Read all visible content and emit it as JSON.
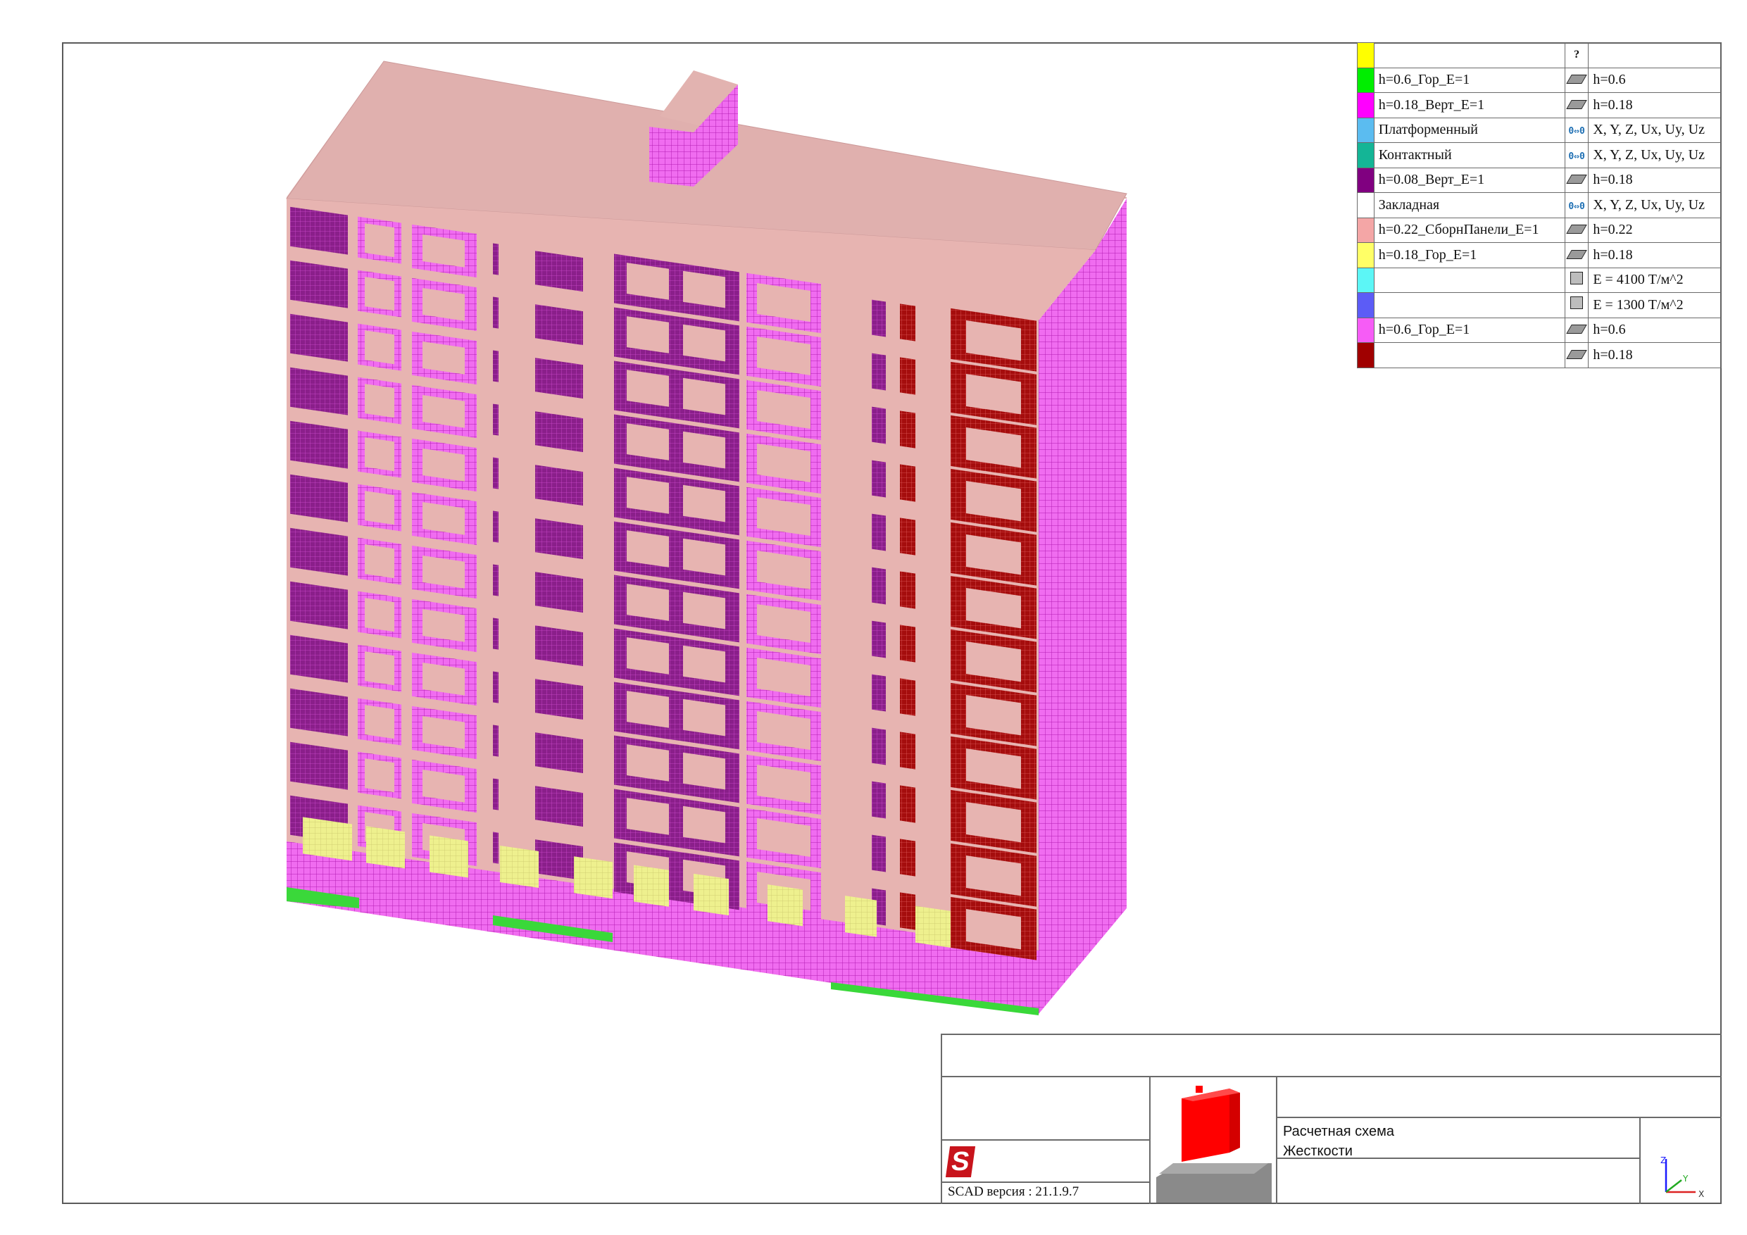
{
  "legend": {
    "header": {
      "icon": "?",
      "color": "#ffff00"
    },
    "rows": [
      {
        "color": "#00ee00",
        "name": "h=0.6_Гор_E=1",
        "icon": "plate-icon",
        "value": "h=0.6"
      },
      {
        "color": "#ff00ff",
        "name": "h=0.18_Верт_E=1",
        "icon": "plate-icon",
        "value": "h=0.18"
      },
      {
        "color": "#5bbcf0",
        "name": "Платформенный",
        "icon": "link-icon",
        "value": "X, Y, Z, Ux, Uy, Uz"
      },
      {
        "color": "#14b596",
        "name": "Контактный",
        "icon": "link-icon",
        "value": "X, Y, Z, Ux, Uy, Uz"
      },
      {
        "color": "#800080",
        "name": "h=0.08_Верт_E=1",
        "icon": "plate-icon",
        "value": "h=0.18"
      },
      {
        "color": "#ffffff",
        "name": "Закладная",
        "icon": "link-icon",
        "value": "X, Y, Z, Ux, Uy, Uz"
      },
      {
        "color": "#f4a6a6",
        "name": "h=0.22_СборнПанели_E=1",
        "icon": "plate-icon",
        "value": "h=0.22"
      },
      {
        "color": "#ffff66",
        "name": "h=0.18_Гор_E=1",
        "icon": "plate-icon",
        "value": "h=0.18"
      },
      {
        "color": "#5cf6f6",
        "name": "",
        "icon": "solid-icon",
        "value": "E = 4100 Т/м^2"
      },
      {
        "color": "#5c5cf6",
        "name": "",
        "icon": "solid-icon",
        "value": "E = 1300 Т/м^2"
      },
      {
        "color": "#f65cf6",
        "name": "h=0.6_Гор_E=1",
        "icon": "plate-icon",
        "value": "h=0.6"
      },
      {
        "color": "#a00000",
        "name": "",
        "icon": "plate-icon",
        "value": "h=0.18"
      }
    ]
  },
  "titleblock": {
    "version_label": "SCAD версия : 21.1.9.7",
    "line1": "Расчетная схема",
    "line2": "Жесткости",
    "axes": {
      "z": "Z",
      "y": "Y",
      "x": "X"
    }
  },
  "colors": {
    "roof": "#e0b0ae",
    "facade": "#e7b4b1",
    "side": "#ee6ee8",
    "mesh": "#ff3dff",
    "purple": "#8a1f8a",
    "red": "#a50d0d",
    "yellow": "#eef08e",
    "green": "#3ad83a"
  }
}
